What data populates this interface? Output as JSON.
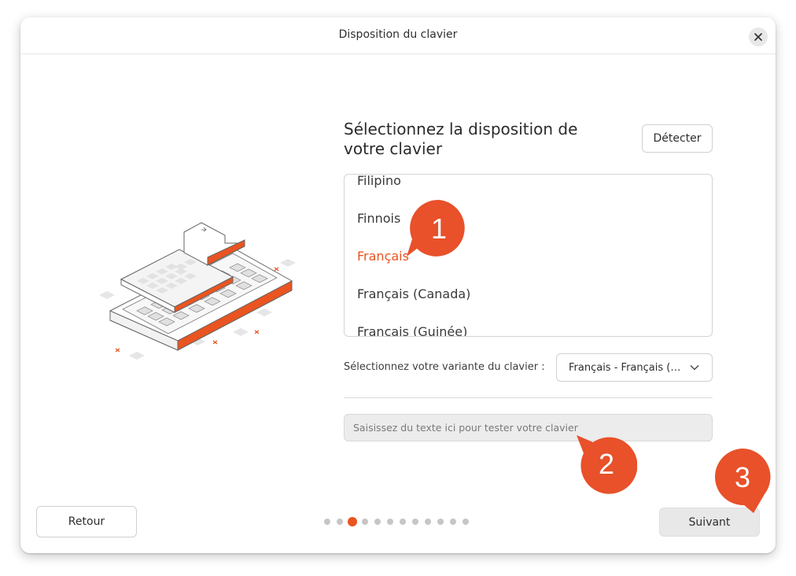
{
  "window": {
    "title": "Disposition du clavier"
  },
  "main": {
    "heading": "Sélectionnez la disposition de votre clavier",
    "detect_label": "Détecter",
    "layouts": [
      {
        "label": "Filipino",
        "selected": false
      },
      {
        "label": "Finnois",
        "selected": false
      },
      {
        "label": "Français",
        "selected": true
      },
      {
        "label": "Français (Canada)",
        "selected": false
      },
      {
        "label": "Français (Guinée)",
        "selected": false
      }
    ],
    "variant_label": "Sélectionnez votre variante du clavier :",
    "variant_value": "Français - Français (…",
    "test_placeholder": "Saisissez du texte ici pour tester votre clavier"
  },
  "footer": {
    "back_label": "Retour",
    "next_label": "Suivant",
    "steps_total": 12,
    "steps_current": 3
  },
  "annotations": [
    "1",
    "2",
    "3"
  ],
  "colors": {
    "accent": "#e95420",
    "callout": "#e8512a"
  },
  "icons": [
    "close-icon",
    "chevron-down-icon",
    "keyboard-illustration"
  ]
}
